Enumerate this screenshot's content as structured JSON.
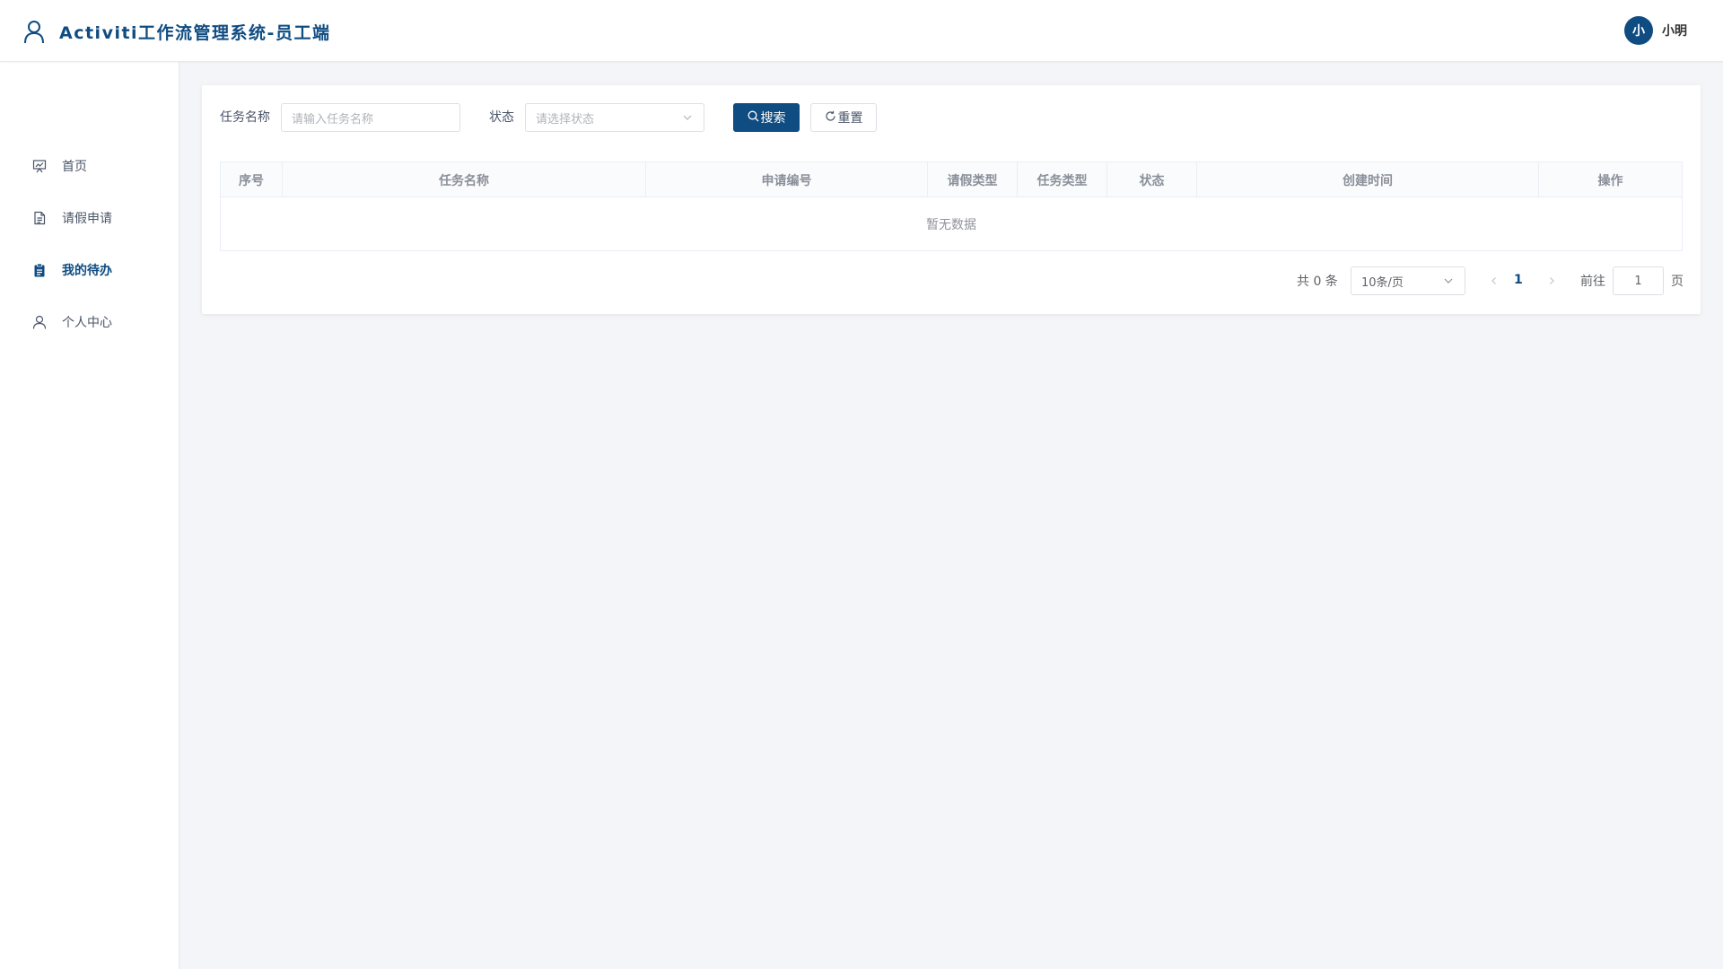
{
  "header": {
    "title": "Activiti工作流管理系统-员工端",
    "avatar_text": "小",
    "username": "小明",
    "brand_icon": "user-outline-icon"
  },
  "sidebar": {
    "items": [
      {
        "label": "首页",
        "icon": "presentation-board-icon",
        "active": false
      },
      {
        "label": "请假申请",
        "icon": "document-icon",
        "active": false
      },
      {
        "label": "我的待办",
        "icon": "clipboard-icon",
        "active": true
      },
      {
        "label": "个人中心",
        "icon": "user-icon",
        "active": false
      }
    ]
  },
  "filters": {
    "task_name_label": "任务名称",
    "task_name_placeholder": "请输入任务名称",
    "status_label": "状态",
    "status_placeholder": "请选择状态",
    "search_label": "搜索",
    "reset_label": "重置"
  },
  "table": {
    "columns": [
      "序号",
      "任务名称",
      "申请编号",
      "请假类型",
      "任务类型",
      "状态",
      "创建时间",
      "操作"
    ],
    "rows": [],
    "empty_text": "暂无数据"
  },
  "pagination": {
    "total_text": "共 0 条",
    "page_size": "10条/页",
    "current_page": "1",
    "goto_label": "前往",
    "goto_value": "1",
    "page_suffix": "页"
  },
  "colors": {
    "primary": "#0f4c81",
    "background": "#f4f5f8"
  }
}
